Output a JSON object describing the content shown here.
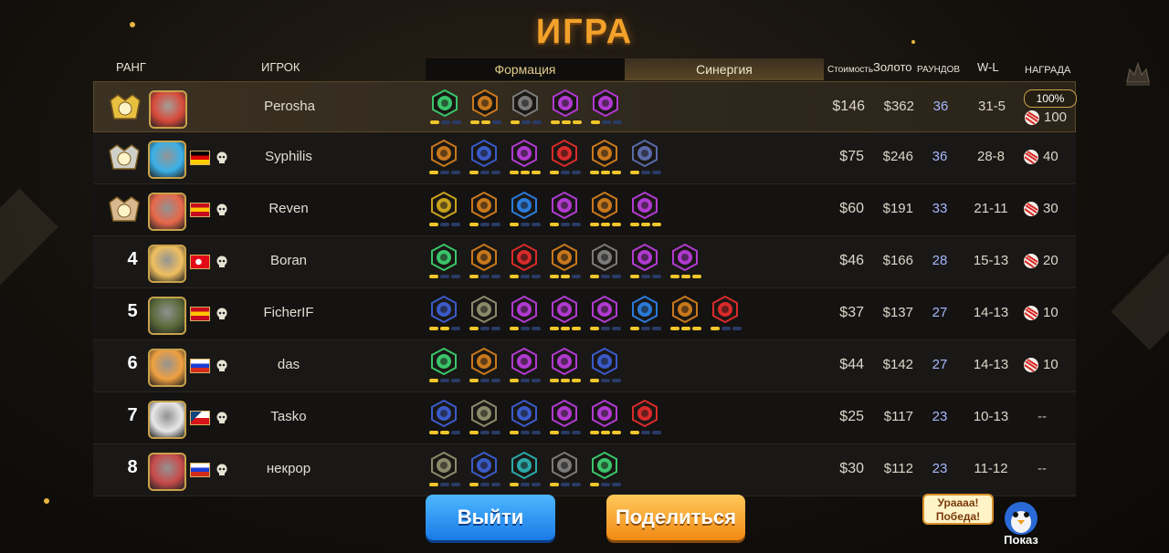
{
  "title": "ИГРА",
  "headers": {
    "rank": "РАНГ",
    "player": "ИГРОК",
    "formation_tab": "Формация",
    "synergy_tab": "Синергия",
    "cost": "Стоимость",
    "gold": "Золото",
    "rounds": "РАУНДОВ",
    "wl": "W-L",
    "reward": "НАГРАДА"
  },
  "players": [
    {
      "rank": "1",
      "name": "Perosha",
      "cost": "$146",
      "gold": "$362",
      "rounds": "36",
      "wl": "31-5",
      "reward": "100",
      "bonus": "100%",
      "medal": "gold",
      "flag": "none",
      "avatar_color": "#d84a3a",
      "synergies": [
        {
          "color": "#3ac46a",
          "bars": [
            1,
            0,
            0
          ]
        },
        {
          "color": "#c8781c",
          "bars": [
            1,
            1,
            0
          ]
        },
        {
          "color": "#7a7a7a",
          "bars": [
            1,
            0,
            0
          ]
        },
        {
          "color": "#b03ad0",
          "bars": [
            1,
            1,
            1
          ]
        },
        {
          "color": "#b03ad0",
          "bars": [
            1,
            0,
            0
          ]
        }
      ]
    },
    {
      "rank": "2",
      "name": "Syphilis",
      "cost": "$75",
      "gold": "$246",
      "rounds": "36",
      "wl": "28-8",
      "reward": "40",
      "medal": "silver",
      "flag": "de",
      "avatar_color": "#3ab0e8",
      "synergies": [
        {
          "color": "#c8781c",
          "bars": [
            1,
            0,
            0
          ]
        },
        {
          "color": "#3a5ac8",
          "bars": [
            1,
            0,
            0
          ]
        },
        {
          "color": "#b03ad0",
          "bars": [
            1,
            1,
            1
          ]
        },
        {
          "color": "#d82a2a",
          "bars": [
            1,
            0,
            0
          ]
        },
        {
          "color": "#c8781c",
          "bars": [
            1,
            1,
            1
          ]
        },
        {
          "color": "#5a6aa8",
          "bars": [
            1,
            0,
            0
          ]
        }
      ]
    },
    {
      "rank": "3",
      "name": "Reven",
      "cost": "$60",
      "gold": "$191",
      "rounds": "33",
      "wl": "21-11",
      "reward": "30",
      "medal": "bronze",
      "flag": "es",
      "avatar_color": "#e8684a",
      "synergies": [
        {
          "color": "#c8a21c",
          "bars": [
            1,
            0,
            0
          ]
        },
        {
          "color": "#c8781c",
          "bars": [
            1,
            0,
            0
          ]
        },
        {
          "color": "#2a7ad8",
          "bars": [
            1,
            0,
            0
          ]
        },
        {
          "color": "#b03ad0",
          "bars": [
            1,
            0,
            0
          ]
        },
        {
          "color": "#c8781c",
          "bars": [
            1,
            1,
            1
          ]
        },
        {
          "color": "#b03ad0",
          "bars": [
            1,
            1,
            1
          ]
        }
      ]
    },
    {
      "rank": "4",
      "name": "Boran",
      "cost": "$46",
      "gold": "$166",
      "rounds": "28",
      "wl": "15-13",
      "reward": "20",
      "medal": "none",
      "flag": "tr",
      "avatar_color": "#f0c060",
      "synergies": [
        {
          "color": "#3ac46a",
          "bars": [
            1,
            0,
            0
          ]
        },
        {
          "color": "#c8781c",
          "bars": [
            1,
            0,
            0
          ]
        },
        {
          "color": "#d82a2a",
          "bars": [
            1,
            0,
            0
          ]
        },
        {
          "color": "#c8781c",
          "bars": [
            1,
            1,
            0
          ]
        },
        {
          "color": "#7a7a7a",
          "bars": [
            1,
            0,
            0
          ]
        },
        {
          "color": "#b03ad0",
          "bars": [
            1,
            0,
            0
          ]
        },
        {
          "color": "#b03ad0",
          "bars": [
            1,
            1,
            1
          ]
        }
      ]
    },
    {
      "rank": "5",
      "name": "FicherIF",
      "cost": "$37",
      "gold": "$137",
      "rounds": "27",
      "wl": "14-13",
      "reward": "10",
      "medal": "none",
      "flag": "es",
      "avatar_color": "#5a6a3a",
      "synergies": [
        {
          "color": "#3a5ac8",
          "bars": [
            1,
            1,
            0
          ]
        },
        {
          "color": "#8a8a6a",
          "bars": [
            1,
            0,
            0
          ]
        },
        {
          "color": "#b03ad0",
          "bars": [
            1,
            0,
            0
          ]
        },
        {
          "color": "#b03ad0",
          "bars": [
            1,
            1,
            1
          ]
        },
        {
          "color": "#b03ad0",
          "bars": [
            1,
            0,
            0
          ]
        },
        {
          "color": "#2a7ad8",
          "bars": [
            1,
            0,
            0
          ]
        },
        {
          "color": "#c8781c",
          "bars": [
            1,
            1,
            1
          ]
        },
        {
          "color": "#d82a2a",
          "bars": [
            1,
            0,
            0
          ]
        }
      ]
    },
    {
      "rank": "6",
      "name": "das",
      "cost": "$44",
      "gold": "$142",
      "rounds": "27",
      "wl": "14-13",
      "reward": "10",
      "medal": "none",
      "flag": "ru",
      "avatar_color": "#f0a040",
      "synergies": [
        {
          "color": "#3ac46a",
          "bars": [
            1,
            0,
            0
          ]
        },
        {
          "color": "#c8781c",
          "bars": [
            1,
            0,
            0
          ]
        },
        {
          "color": "#b03ad0",
          "bars": [
            1,
            0,
            0
          ]
        },
        {
          "color": "#b03ad0",
          "bars": [
            1,
            1,
            1
          ]
        },
        {
          "color": "#3a5ac8",
          "bars": [
            1,
            0,
            0
          ]
        }
      ]
    },
    {
      "rank": "7",
      "name": "Tasko",
      "cost": "$25",
      "gold": "$117",
      "rounds": "23",
      "wl": "10-13",
      "reward": "--",
      "medal": "none",
      "flag": "cz",
      "avatar_color": "#e8e8e8",
      "synergies": [
        {
          "color": "#3a5ac8",
          "bars": [
            1,
            1,
            0
          ]
        },
        {
          "color": "#8a8a6a",
          "bars": [
            1,
            0,
            0
          ]
        },
        {
          "color": "#3a5ac8",
          "bars": [
            1,
            0,
            0
          ]
        },
        {
          "color": "#b03ad0",
          "bars": [
            1,
            0,
            0
          ]
        },
        {
          "color": "#b03ad0",
          "bars": [
            1,
            1,
            1
          ]
        },
        {
          "color": "#d82a2a",
          "bars": [
            1,
            0,
            0
          ]
        }
      ]
    },
    {
      "rank": "8",
      "name": "некрор",
      "cost": "$30",
      "gold": "$112",
      "rounds": "23",
      "wl": "11-12",
      "reward": "--",
      "medal": "none",
      "flag": "ru",
      "avatar_color": "#c84a4a",
      "synergies": [
        {
          "color": "#8a8a6a",
          "bars": [
            1,
            0,
            0
          ]
        },
        {
          "color": "#3a5ac8",
          "bars": [
            1,
            0,
            0
          ]
        },
        {
          "color": "#2aa8a8",
          "bars": [
            1,
            0,
            0
          ]
        },
        {
          "color": "#7a7a7a",
          "bars": [
            1,
            0,
            0
          ]
        },
        {
          "color": "#3ac46a",
          "bars": [
            1,
            0,
            0
          ]
        }
      ]
    }
  ],
  "buttons": {
    "exit": "Выйти",
    "share": "Поделиться"
  },
  "mascot": {
    "bubble_line1": "Урaaaa!",
    "bubble_line2": "Победа!",
    "show_label": "Показ"
  }
}
